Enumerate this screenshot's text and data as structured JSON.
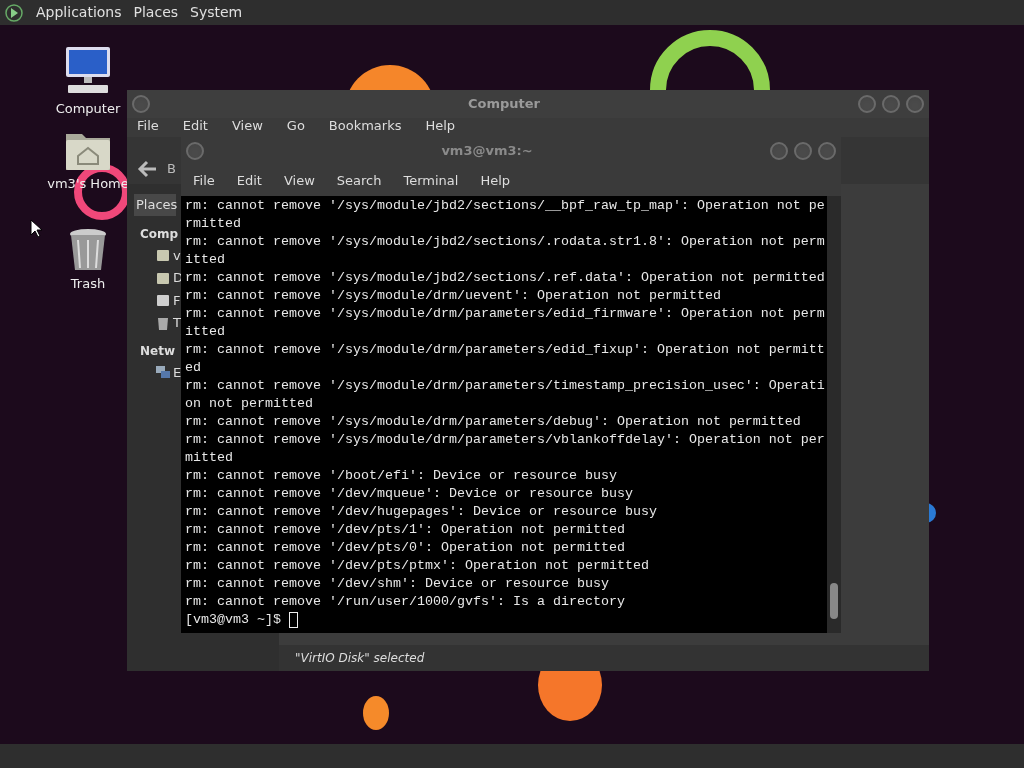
{
  "top_panel": {
    "menus": [
      "Applications",
      "Places",
      "System"
    ]
  },
  "desktop_icons": [
    {
      "label": "Computer",
      "kind": "computer"
    },
    {
      "label": "vm3's Home",
      "kind": "home"
    },
    {
      "label": "Trash",
      "kind": "trash"
    }
  ],
  "file_manager": {
    "title": "Computer",
    "menu": [
      "File",
      "Edit",
      "View",
      "Go",
      "Bookmarks",
      "Help"
    ],
    "back_label": "B",
    "sidebar_tab": "Places",
    "sections": [
      {
        "heading": "Comp",
        "items": [
          {
            "kind": "home",
            "label": "v"
          },
          {
            "kind": "desktop",
            "label": "D"
          },
          {
            "kind": "disk",
            "label": "F"
          },
          {
            "kind": "trash",
            "label": "T"
          }
        ]
      },
      {
        "heading": "Netw",
        "items": [
          {
            "kind": "network",
            "label": "E"
          }
        ]
      }
    ],
    "status": "\"VirtIO Disk\" selected"
  },
  "terminal": {
    "title": "vm3@vm3:~",
    "menu": [
      "File",
      "Edit",
      "View",
      "Search",
      "Terminal",
      "Help"
    ],
    "lines": [
      "rm: cannot remove '/sys/module/jbd2/sections/__bpf_raw_tp_map': Operation not pe",
      "rmitted",
      "rm: cannot remove '/sys/module/jbd2/sections/.rodata.str1.8': Operation not perm",
      "itted",
      "rm: cannot remove '/sys/module/jbd2/sections/.ref.data': Operation not permitted",
      "rm: cannot remove '/sys/module/drm/uevent': Operation not permitted",
      "rm: cannot remove '/sys/module/drm/parameters/edid_firmware': Operation not perm",
      "itted",
      "rm: cannot remove '/sys/module/drm/parameters/edid_fixup': Operation not permitt",
      "ed",
      "rm: cannot remove '/sys/module/drm/parameters/timestamp_precision_usec': Operati",
      "on not permitted",
      "rm: cannot remove '/sys/module/drm/parameters/debug': Operation not permitted",
      "rm: cannot remove '/sys/module/drm/parameters/vblankoffdelay': Operation not per",
      "mitted",
      "rm: cannot remove '/boot/efi': Device or resource busy",
      "rm: cannot remove '/dev/mqueue': Device or resource busy",
      "rm: cannot remove '/dev/hugepages': Device or resource busy",
      "rm: cannot remove '/dev/pts/1': Operation not permitted",
      "rm: cannot remove '/dev/pts/0': Operation not permitted",
      "rm: cannot remove '/dev/pts/ptmx': Operation not permitted",
      "rm: cannot remove '/dev/shm': Device or resource busy",
      "rm: cannot remove '/run/user/1000/gvfs': Is a directory"
    ],
    "prompt": "[vm3@vm3 ~]$"
  }
}
